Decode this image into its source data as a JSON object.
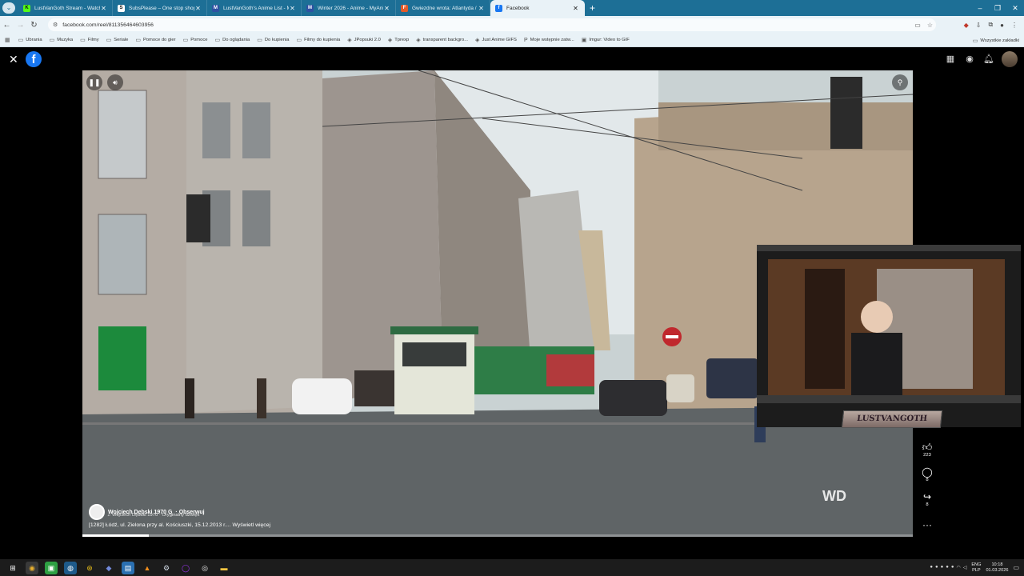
{
  "tabs": [
    {
      "title": "LustVanGoth Stream - Watch Li",
      "favicon": "K",
      "favicon_color": "#53fc18",
      "active": false
    },
    {
      "title": "SubsPlease – One stop shop for",
      "favicon": "S",
      "favicon_color": "#ffffff",
      "active": false
    },
    {
      "title": "LustVanGoth's Anime List - My",
      "favicon": "M",
      "favicon_color": "#2e51a2",
      "active": false
    },
    {
      "title": "Winter 2026 - Anime - MyAnime",
      "favicon": "M",
      "favicon_color": "#2e51a2",
      "active": false
    },
    {
      "title": "Gwiezdne wrota: Atlantyda / St",
      "favicon": "F",
      "favicon_color": "#e35b2b",
      "active": false
    },
    {
      "title": "Facebook",
      "favicon": "f",
      "favicon_color": "#1877f2",
      "active": true
    }
  ],
  "address": {
    "url": "facebook.com/reel/811356464603956"
  },
  "bookmarks": [
    {
      "label": "Ubrania",
      "icon": "folder-icon"
    },
    {
      "label": "Muzyka",
      "icon": "folder-icon"
    },
    {
      "label": "Filmy",
      "icon": "folder-icon"
    },
    {
      "label": "Seriale",
      "icon": "folder-icon"
    },
    {
      "label": "Pomoce do gier",
      "icon": "folder-icon"
    },
    {
      "label": "Pomoce",
      "icon": "folder-icon"
    },
    {
      "label": "Do oglądania",
      "icon": "folder-icon"
    },
    {
      "label": "Do kupienia",
      "icon": "folder-icon"
    },
    {
      "label": "Filmy do kupienia",
      "icon": "folder-icon"
    },
    {
      "label": "JPopsuki 2.0",
      "icon": "site-icon"
    },
    {
      "label": "Tprexp",
      "icon": "site-icon"
    },
    {
      "label": "transparent backgro...",
      "icon": "site-icon"
    },
    {
      "label": "Just Anime GIFS",
      "icon": "site-icon"
    },
    {
      "label": "Moje wstępnie zatw...",
      "icon": "paypal-icon"
    },
    {
      "label": "Imgur: Video to GIF",
      "icon": "imgur-icon"
    }
  ],
  "bookmarks_all": "Wszystkie zakładki",
  "reel": {
    "author": "Wojciech Dębski 1970 G",
    "follow": "· Obserwuj",
    "audio": "♫ Wojciech Dębski 1970 · Oryginalny dźwięk",
    "caption": "[1282] Łódź, ul. Zielona przy al. Kościuszki, 15.12.2013 r.... Wyświetl więcej",
    "watermark": "WD",
    "progress": 0.08,
    "likes": "223",
    "comments": "8",
    "shares": "8"
  },
  "webcam": {
    "name_plate": "LUSTVANGOTH"
  },
  "system": {
    "lang_top": "ENG",
    "lang_bottom": "PLP",
    "time": "10:18",
    "date": "01.03.2026"
  },
  "colors": {
    "tab_strip": "#1d6f96",
    "toolbar": "#e9f2f7",
    "facebook": "#1877f2"
  }
}
